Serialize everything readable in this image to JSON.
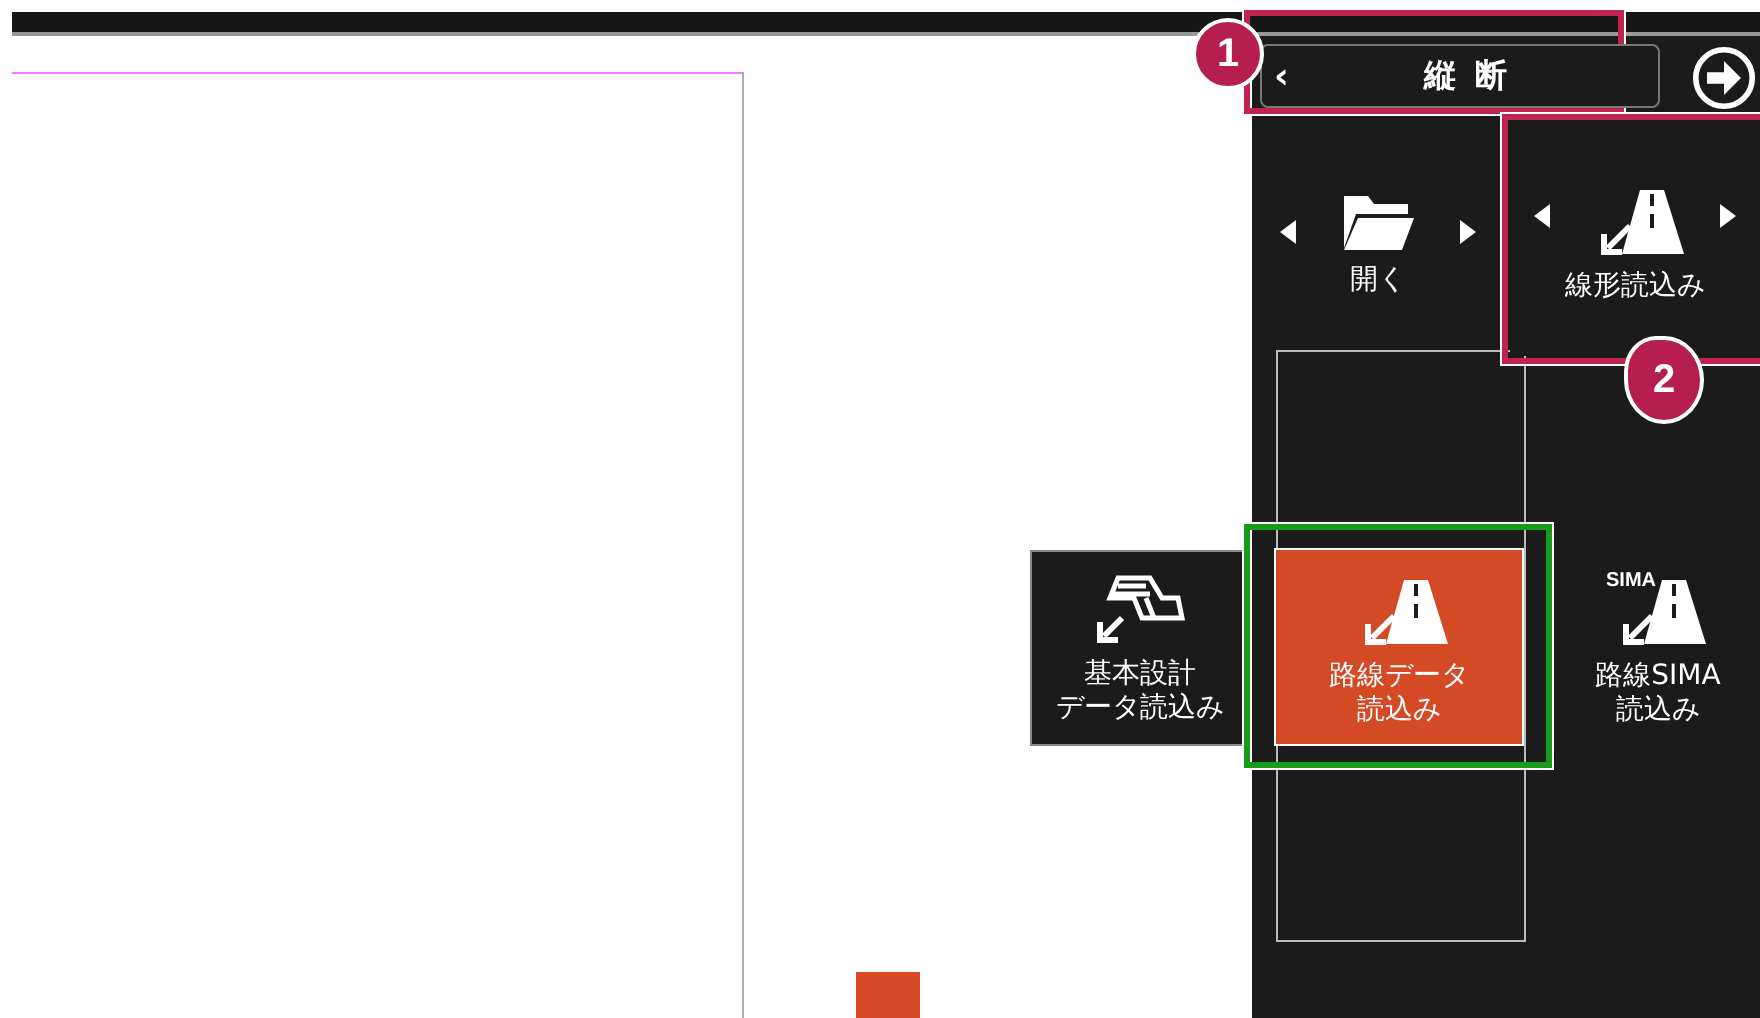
{
  "header": {
    "back": "‹",
    "title": "縦 断"
  },
  "tiles": [
    {
      "lines": [
        "開く"
      ],
      "kind": "folder",
      "selected": false,
      "arrows": true
    },
    {
      "lines": [
        "線形読込み"
      ],
      "kind": "road",
      "selected": false,
      "arrows": true
    },
    {
      "lines": [
        "基本設計",
        "データ読込み"
      ],
      "kind": "structure",
      "selected": false,
      "arrows": false
    },
    {
      "lines": [
        "路線データ",
        "読込み"
      ],
      "kind": "road",
      "selected": true,
      "arrows": false
    },
    {
      "lines": [
        "路線SIMA",
        "読込み"
      ],
      "kind": "sima",
      "icon_text": "SIMA",
      "selected": false,
      "arrows": false
    }
  ],
  "callouts": [
    {
      "number": "1",
      "kind": "circle"
    },
    {
      "number": "2",
      "kind": "pointer"
    }
  ]
}
